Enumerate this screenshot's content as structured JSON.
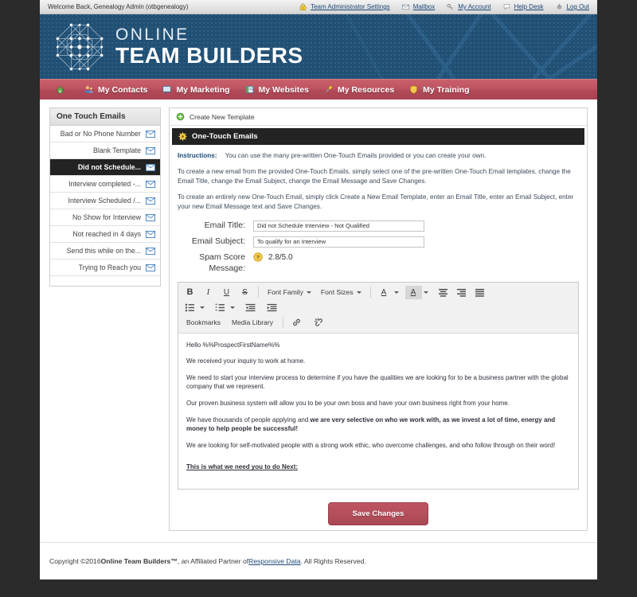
{
  "utility_bar": {
    "welcome": "Welcome Back, Genealogy Admin (otbgenealogy)",
    "links": [
      {
        "icon": "lock-icon",
        "label": "Team Administrator Settings"
      },
      {
        "icon": "envelope-icon",
        "label": "Mailbox"
      },
      {
        "icon": "key-icon",
        "label": "My Account"
      },
      {
        "icon": "speech-bubble-icon",
        "label": "Help Desk"
      },
      {
        "icon": "power-icon",
        "label": "Log Out"
      }
    ]
  },
  "banner": {
    "logo_line1": "ONLINE",
    "logo_line2": "TEAM BUILDERS",
    "bg_color": "#215075"
  },
  "nav": {
    "bg_color": "#b24a58",
    "items": [
      {
        "icon": "home-icon",
        "label": ""
      },
      {
        "icon": "contacts-icon",
        "label": "My Contacts"
      },
      {
        "icon": "monitor-icon",
        "label": "My Marketing"
      },
      {
        "icon": "window-icon",
        "label": "My Websites"
      },
      {
        "icon": "microphone-icon",
        "label": "My Resources"
      },
      {
        "icon": "shield-icon",
        "label": "My Training"
      }
    ]
  },
  "sidebar": {
    "title": "One Touch Emails",
    "items": [
      {
        "label": "Bad or No Phone Number",
        "active": false
      },
      {
        "label": "Blank Template",
        "active": false
      },
      {
        "label": "Did not Schedule...",
        "active": true
      },
      {
        "label": "Interview completed -...",
        "active": false
      },
      {
        "label": "Interview Scheduled /...",
        "active": false
      },
      {
        "label": "No Show for Interview",
        "active": false
      },
      {
        "label": "Not reached in 4 days",
        "active": false
      },
      {
        "label": "Send this while on the...",
        "active": false
      },
      {
        "label": "Trying to Reach you",
        "active": false
      }
    ]
  },
  "main": {
    "create_new_template": "Create New Template",
    "section_title": "One-Touch Emails",
    "instructions_label": "Instructions:",
    "instructions_lead": "You can use the many pre-written One-Touch Emails provided or you can create your own.",
    "instructions_p1": "To create a new email from the provided One-Touch Emails, simply select one of the pre-written One-Touch Email templates, change the Email Title, change the Email Subject, change the Email Message and Save Changes.",
    "instructions_p2": "To create an entirely new One-Touch Email, simply click Create a New Email Template, enter an Email Title, enter an Email Subject, enter your new Email Message text and Save Changes.",
    "form": {
      "email_title_label": "Email Title:",
      "email_title_value": "Did not Schedule Interview - Not Qualified",
      "email_subject_label": "Email Subject:",
      "email_subject_value": "To qualify for an Interview",
      "spam_score_label_line1": "Spam Score",
      "spam_score_label_line2": "Message:",
      "spam_score_value": "2.8/5.0"
    },
    "toolbar": {
      "bold": "B",
      "italic": "I",
      "underline": "U",
      "strikethrough": "S",
      "font_family": "Font Family",
      "font_sizes": "Font Sizes",
      "text_color": "A",
      "background_color": "A",
      "bookmarks": "Bookmarks",
      "media_library": "Media Library"
    },
    "message_body": {
      "p1": "Hello %%ProspectFirstName%%",
      "p2": "We received your inquiry to work at home.",
      "p3": "We need to start your interview process to determine if you have the qualities we are looking for to be a business partner with the global company that we represent.",
      "p4": "Our proven business system will allow you to be your own boss and have your own business right from your home.",
      "p5_plain": "We have thousands of people applying and ",
      "p5_bold": "we are very selective on who we work with, as we invest a lot of time, energy and money to help people be successful!",
      "p6": "We are looking for self-motivated people with a strong work ethic, who overcome challenges, and who follow through on their word!",
      "p7": "This is what we need you to do Next:"
    },
    "save_button": "Save Changes"
  },
  "footer": {
    "copyright_pre": "Copyright ©2016 ",
    "brand": "Online Team Builders™",
    "mid": ", an Affiliated Partner of ",
    "link": "Responsive Data",
    "post": ". All Rights Reserved."
  }
}
